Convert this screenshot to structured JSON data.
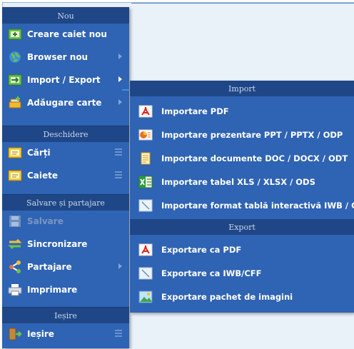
{
  "colors": {
    "menu_bg": "#2f63b3",
    "header_bg": "#1f4787",
    "header_text": "#c9d6ea",
    "item_text": "#ffffff",
    "disabled_text": "#7b97c2",
    "arrow_accent": "#3ba6e8"
  },
  "main_menu": {
    "section_new": "Nou",
    "item_new_notebook": "Creare caiet nou",
    "item_new_browser": "Browser nou",
    "item_import_export": "Import / Export",
    "item_add_book": "Adăugare carte",
    "section_open": "Deschidere",
    "item_books": "Cărți",
    "item_notebooks": "Caiete",
    "section_save_share": "Salvare și partajare",
    "item_save": "Salvare",
    "item_sync": "Sincronizare",
    "item_share": "Partajare",
    "item_print": "Imprimare",
    "section_exit": "Ieșire",
    "item_exit": "Ieșire"
  },
  "submenu": {
    "section_import": "Import",
    "import_pdf": "Importare PDF",
    "import_presentation": "Importare prezentare PPT / PPTX / ODP",
    "import_documents": "Importare documente DOC / DOCX / ODT",
    "import_spreadsheet": "Importare tabel XLS / XLSX / ODS",
    "import_whiteboard": "Importare format tablă interactivă IWB / CFF",
    "section_export": "Export",
    "export_pdf": "Exportare ca PDF",
    "export_iwb": "Exportare ca IWB/CFF",
    "export_images": "Exportare pachet de imagini"
  },
  "icons": {
    "new_notebook": "notebook-add-icon",
    "new_browser": "globe-icon",
    "import_export": "import-export-icon",
    "add_book": "add-book-icon",
    "books": "books-icon",
    "notebooks": "notebooks-icon",
    "save": "save-icon",
    "sync": "sync-icon",
    "share": "share-icon",
    "print": "print-icon",
    "exit": "exit-door-icon",
    "pdf": "pdf-icon",
    "presentation": "presentation-icon",
    "document": "document-icon",
    "spreadsheet": "spreadsheet-icon",
    "whiteboard": "whiteboard-icon",
    "image_pack": "image-pack-icon"
  }
}
